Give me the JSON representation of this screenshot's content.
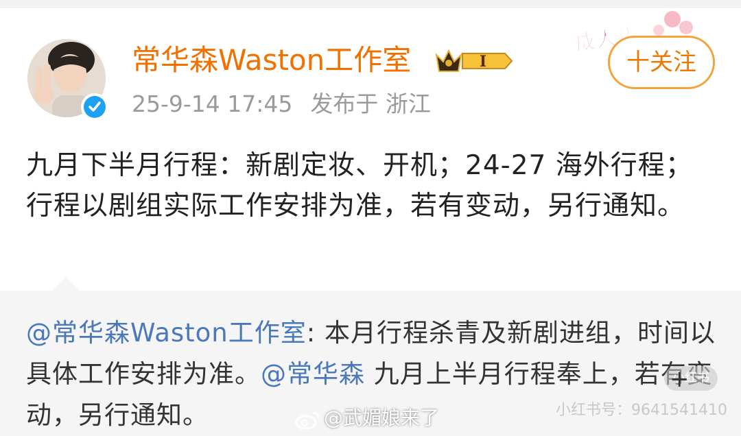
{
  "header": {
    "username": "常华森Waston工作室",
    "vip_level": "I",
    "timestamp": "25-9-14 17:45",
    "location_label": "发布于 浙江",
    "follow_label": "十关注",
    "sticker_text": "成人礼"
  },
  "post": {
    "text": "九月下半月行程：新剧定妆、开机；24-27 海外行程；行程以剧组实际工作安排为准，若有变动，另行通知。"
  },
  "repost": {
    "mention_author": "@常华森Waston工作室",
    "text_part1": ": 本月行程杀青及新剧进组，时间以具体工作安排为准。",
    "mention_person": "@常华森",
    "text_part2": " 九月上半月行程奉上，若有变动，另行通知。"
  },
  "watermarks": {
    "weibo": "@武媚娘来了",
    "xhs_logo": "小红书",
    "xhs_id": "小红书号：9641541410"
  },
  "colors": {
    "username": "#f07000",
    "follow_border": "#f3a23c",
    "mention": "#4a78b8",
    "verified": "#1da1f2",
    "repost_bg": "#f5f5f5"
  },
  "icons": {
    "verified": "verified-check-icon",
    "vip": "crown-badge-icon",
    "weibo": "weibo-logo-icon"
  }
}
